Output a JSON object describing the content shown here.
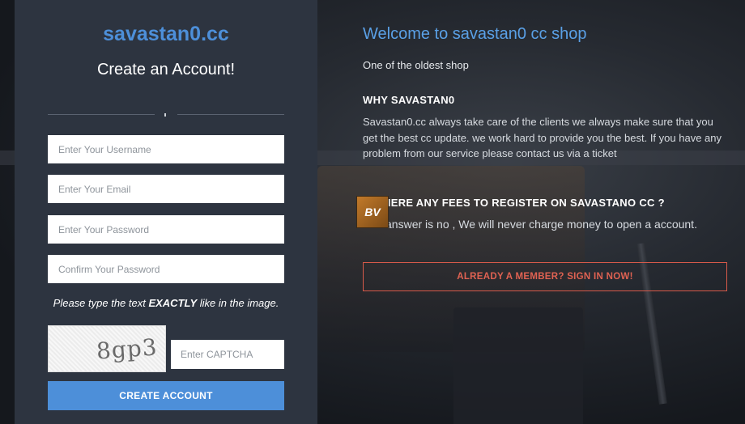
{
  "register": {
    "brand": "savastan0.cc",
    "heading": "Create an Account!",
    "username_placeholder": "Enter Your Username",
    "email_placeholder": "Enter Your Email",
    "password_placeholder": "Enter Your Password",
    "confirm_placeholder": "Confirm Your Password",
    "captcha_note_pre": "Please type the text ",
    "captcha_note_bold": "EXACTLY",
    "captcha_note_post": " like in the image.",
    "captcha_text": "8gp3",
    "captcha_placeholder": "Enter CAPTCHA",
    "create_label": "CREATE ACCOUNT"
  },
  "info": {
    "welcome": "Welcome to savastan0 cc shop",
    "tagline": "One of the oldest shop",
    "why_heading": "WHY SAVASTAN0",
    "why_body": "Savastan0.cc always take care of the clients we always make sure that you get the best cc update. we work hard to provide you the best. If you have any problem from our service please contact us via a ticket",
    "fees_heading": "IS THERE ANY FEES TO REGISTER ON SAVASTANO CC ?",
    "fees_body": "The answer is no , We will never charge money to open a account.",
    "badge_text": "BV",
    "signin_label": "ALREADY A MEMBER? SIGN IN NOW!"
  },
  "colors": {
    "brand_blue": "#4d8fd9",
    "panel": "#2d3440",
    "signin_red": "#e06252"
  }
}
